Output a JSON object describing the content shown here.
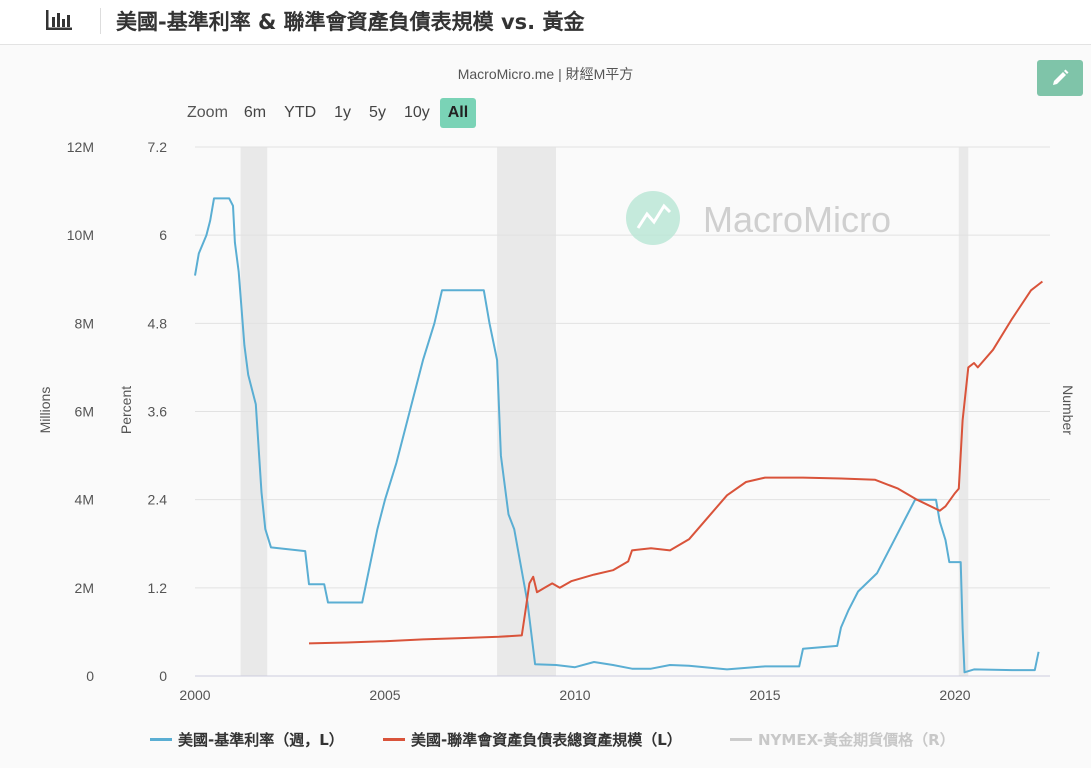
{
  "header": {
    "title": "美國-基準利率 & 聯準會資產負債表規模 vs. 黃金",
    "icon": "bar-chart-icon"
  },
  "source_label": "MacroMicro.me | 財經M平方",
  "watermark": "MacroMicro",
  "edit_button": {
    "icon": "pencil-icon",
    "color": "#7fc4a9"
  },
  "zoom": {
    "label": "Zoom",
    "buttons": [
      "6m",
      "YTD",
      "1y",
      "5y",
      "10y",
      "All"
    ],
    "active": "All"
  },
  "colors": {
    "rate": "#5aaed3",
    "balance_sheet": "#d9533a",
    "gold": "#cccccc",
    "recession_band": "#e9e9e9",
    "accent": "#7ad3b6"
  },
  "chart_data": {
    "type": "line",
    "x_ticks": [
      "2000",
      "2005",
      "2010",
      "2015",
      "2020"
    ],
    "x_range": [
      2000,
      2022.5
    ],
    "left_axis_1": {
      "title": "Millions",
      "ticks": [
        "0",
        "2M",
        "4M",
        "6M",
        "8M",
        "10M",
        "12M"
      ],
      "range": [
        0,
        12000000
      ]
    },
    "left_axis_2": {
      "title": "Percent",
      "ticks": [
        "0",
        "1.2",
        "2.4",
        "3.6",
        "4.8",
        "6",
        "7.2"
      ],
      "range": [
        0,
        7.2
      ]
    },
    "right_axis": {
      "title": "Number"
    },
    "grid": true,
    "legend_position": "bottom",
    "recession_bands": [
      [
        2001.2,
        2001.9
      ],
      [
        2007.95,
        2009.5
      ],
      [
        2020.1,
        2020.35
      ]
    ],
    "series": [
      {
        "name": "美國-基準利率（週，L）",
        "axis": "Percent",
        "points": [
          [
            2000.0,
            5.45
          ],
          [
            2000.1,
            5.75
          ],
          [
            2000.3,
            6.0
          ],
          [
            2000.4,
            6.2
          ],
          [
            2000.5,
            6.5
          ],
          [
            2000.9,
            6.5
          ],
          [
            2001.0,
            6.4
          ],
          [
            2001.05,
            5.9
          ],
          [
            2001.15,
            5.5
          ],
          [
            2001.3,
            4.5
          ],
          [
            2001.4,
            4.1
          ],
          [
            2001.6,
            3.7
          ],
          [
            2001.75,
            2.5
          ],
          [
            2001.85,
            2.0
          ],
          [
            2002.0,
            1.75
          ],
          [
            2002.9,
            1.7
          ],
          [
            2003.0,
            1.25
          ],
          [
            2003.4,
            1.25
          ],
          [
            2003.5,
            1.0
          ],
          [
            2004.4,
            1.0
          ],
          [
            2004.5,
            1.25
          ],
          [
            2004.6,
            1.5
          ],
          [
            2004.8,
            2.0
          ],
          [
            2005.0,
            2.4
          ],
          [
            2005.3,
            2.9
          ],
          [
            2005.5,
            3.3
          ],
          [
            2005.75,
            3.8
          ],
          [
            2006.0,
            4.3
          ],
          [
            2006.3,
            4.8
          ],
          [
            2006.5,
            5.25
          ],
          [
            2007.6,
            5.25
          ],
          [
            2007.75,
            4.8
          ],
          [
            2007.95,
            4.3
          ],
          [
            2008.05,
            3.0
          ],
          [
            2008.25,
            2.2
          ],
          [
            2008.4,
            2.0
          ],
          [
            2008.75,
            1.0
          ],
          [
            2008.95,
            0.16
          ],
          [
            2009.5,
            0.15
          ],
          [
            2010.0,
            0.12
          ],
          [
            2010.5,
            0.19
          ],
          [
            2011.0,
            0.15
          ],
          [
            2011.5,
            0.1
          ],
          [
            2012.0,
            0.1
          ],
          [
            2012.5,
            0.15
          ],
          [
            2013.0,
            0.14
          ],
          [
            2014.0,
            0.09
          ],
          [
            2015.0,
            0.13
          ],
          [
            2015.9,
            0.13
          ],
          [
            2016.0,
            0.37
          ],
          [
            2016.9,
            0.41
          ],
          [
            2017.0,
            0.66
          ],
          [
            2017.2,
            0.9
          ],
          [
            2017.45,
            1.15
          ],
          [
            2017.95,
            1.4
          ],
          [
            2018.2,
            1.65
          ],
          [
            2018.45,
            1.9
          ],
          [
            2018.7,
            2.15
          ],
          [
            2018.95,
            2.4
          ],
          [
            2019.5,
            2.4
          ],
          [
            2019.6,
            2.1
          ],
          [
            2019.75,
            1.85
          ],
          [
            2019.85,
            1.55
          ],
          [
            2020.15,
            1.55
          ],
          [
            2020.2,
            0.65
          ],
          [
            2020.25,
            0.05
          ],
          [
            2020.5,
            0.09
          ],
          [
            2021.5,
            0.08
          ],
          [
            2022.1,
            0.08
          ],
          [
            2022.2,
            0.33
          ]
        ]
      },
      {
        "name": "美國-聯準會資產負債表總資產規模（L）",
        "axis": "Millions",
        "points": [
          [
            2003.0,
            740000
          ],
          [
            2004.0,
            760000
          ],
          [
            2005.0,
            790000
          ],
          [
            2006.0,
            830000
          ],
          [
            2007.0,
            860000
          ],
          [
            2008.0,
            890000
          ],
          [
            2008.6,
            920000
          ],
          [
            2008.7,
            1500000
          ],
          [
            2008.8,
            2100000
          ],
          [
            2008.9,
            2250000
          ],
          [
            2009.0,
            1900000
          ],
          [
            2009.2,
            2000000
          ],
          [
            2009.4,
            2100000
          ],
          [
            2009.6,
            2000000
          ],
          [
            2009.9,
            2150000
          ],
          [
            2010.5,
            2300000
          ],
          [
            2011.0,
            2400000
          ],
          [
            2011.4,
            2600000
          ],
          [
            2011.5,
            2850000
          ],
          [
            2012.0,
            2900000
          ],
          [
            2012.5,
            2850000
          ],
          [
            2013.0,
            3100000
          ],
          [
            2013.5,
            3600000
          ],
          [
            2014.0,
            4100000
          ],
          [
            2014.5,
            4400000
          ],
          [
            2015.0,
            4500000
          ],
          [
            2016.0,
            4500000
          ],
          [
            2017.0,
            4480000
          ],
          [
            2017.9,
            4450000
          ],
          [
            2018.5,
            4250000
          ],
          [
            2019.0,
            4000000
          ],
          [
            2019.6,
            3750000
          ],
          [
            2019.75,
            3850000
          ],
          [
            2020.0,
            4150000
          ],
          [
            2020.1,
            4250000
          ],
          [
            2020.2,
            5800000
          ],
          [
            2020.35,
            7000000
          ],
          [
            2020.5,
            7100000
          ],
          [
            2020.6,
            7000000
          ],
          [
            2021.0,
            7400000
          ],
          [
            2021.5,
            8100000
          ],
          [
            2022.0,
            8750000
          ],
          [
            2022.3,
            8950000
          ]
        ]
      },
      {
        "name": "NYMEX-黃金期貨價格（R）",
        "axis": "Number",
        "hidden": true,
        "points": []
      }
    ]
  }
}
